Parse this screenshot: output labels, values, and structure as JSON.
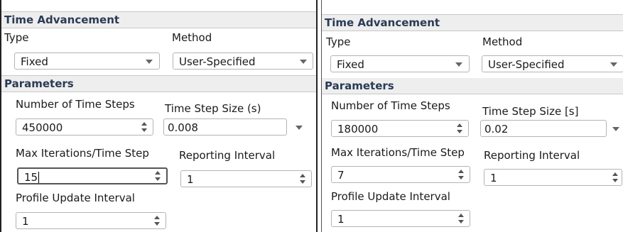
{
  "panel_left": {
    "title": "Time Advancement",
    "type_label": "Type",
    "method_label": "Method",
    "type_value": "Fixed",
    "method_value": "User-Specified",
    "parameters_label": "Parameters",
    "num_steps_label": "Number of Time Steps",
    "num_steps_value": "450000",
    "step_size_label": "Time Step Size (s)",
    "step_size_value": "0.008",
    "max_iter_label": "Max Iterations/Time Step",
    "max_iter_value": "15",
    "reporting_label": "Reporting Interval",
    "reporting_value": "1",
    "profile_label": "Profile Update Interval",
    "profile_value": "1"
  },
  "panel_right": {
    "title": "Time Advancement",
    "type_label": "Type",
    "method_label": "Method",
    "type_value": "Fixed",
    "method_value": "User-Specified",
    "parameters_label": "Parameters",
    "num_steps_label": "Number of Time Steps",
    "num_steps_value": "180000",
    "step_size_label": "Time Step Size [s]",
    "step_size_value": "0.02",
    "max_iter_label": "Max Iterations/Time Step",
    "max_iter_value": "7",
    "reporting_label": "Reporting Interval",
    "reporting_value": "1",
    "profile_label": "Profile Update Interval",
    "profile_value": "1"
  }
}
